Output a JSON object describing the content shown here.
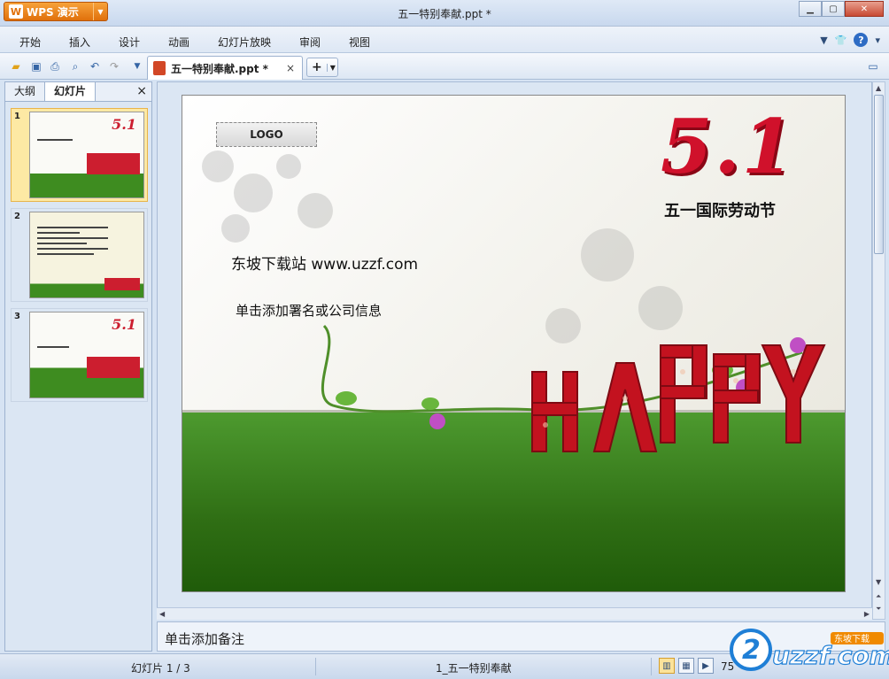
{
  "app": {
    "button_label": "WPS 演示",
    "logo_char": "W",
    "window_title": "五一特别奉献.ppt *"
  },
  "menu": [
    "开始",
    "插入",
    "设计",
    "动画",
    "幻灯片放映",
    "审阅",
    "视图"
  ],
  "toolbar": {
    "doc_tab_title": "五一特别奉献.ppt *",
    "close_glyph": "×",
    "new_tab_glyph": "+"
  },
  "left_panel": {
    "tabs": [
      "大纲",
      "幻灯片"
    ],
    "active_tab": 1,
    "close_glyph": "×",
    "thumbnails": [
      {
        "number": "1"
      },
      {
        "number": "2"
      },
      {
        "number": "3"
      }
    ]
  },
  "slide": {
    "logo_text": "LOGO",
    "big_title": "5.1",
    "festival": "五一国际劳动节",
    "site_text": "东坡下载站 www.uzzf.com",
    "sign_placeholder": "单击添加署名或公司信息",
    "decor_text": "HAPPY"
  },
  "notes_placeholder": "单击添加备注",
  "status": {
    "slide_indicator": "幻灯片 1 / 3",
    "slide_name": "1_五一特别奉献",
    "zoom": "75"
  },
  "watermark": {
    "text": "uzzf.com",
    "badge": "东坡下载"
  },
  "colors": {
    "accent_red": "#d0112b",
    "grass_green": "#3e8c20",
    "app_orange": "#e0700b"
  }
}
